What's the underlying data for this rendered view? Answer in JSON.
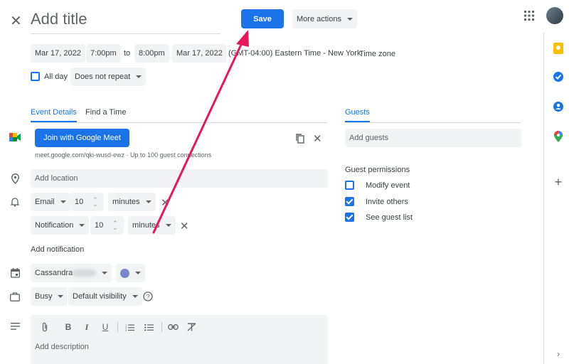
{
  "header": {
    "title_placeholder": "Add title",
    "save_label": "Save",
    "more_actions_label": "More actions"
  },
  "datetime": {
    "start_date": "Mar 17, 2022",
    "start_time": "7:00pm",
    "to_label": "to",
    "end_time": "8:00pm",
    "end_date": "Mar 17, 2022",
    "timezone_text": "(GMT-04:00) Eastern Time - New York",
    "timezone_link": "Time zone",
    "all_day_label": "All day",
    "repeat_label": "Does not repeat"
  },
  "tabs": {
    "event_details": "Event Details",
    "find_time": "Find a Time",
    "guests": "Guests"
  },
  "meet": {
    "button_label": "Join with Google Meet",
    "link_text": "meet.google.com/qki-wusd-ewz · Up to 100 guest connections"
  },
  "location": {
    "placeholder": "Add location"
  },
  "notifications": [
    {
      "type": "Email",
      "amount": "10",
      "unit": "minutes"
    },
    {
      "type": "Notification",
      "amount": "10",
      "unit": "minutes"
    }
  ],
  "add_notification_label": "Add notification",
  "calendar": {
    "owner": "Cassandra",
    "color": "#7986cb"
  },
  "availability": {
    "status": "Busy",
    "visibility": "Default visibility"
  },
  "description": {
    "placeholder": "Add description"
  },
  "guests": {
    "placeholder": "Add guests",
    "permissions_title": "Guest permissions",
    "permissions": [
      {
        "label": "Modify event",
        "checked": false
      },
      {
        "label": "Invite others",
        "checked": true
      },
      {
        "label": "See guest list",
        "checked": true
      }
    ]
  },
  "colors": {
    "accent": "#1a73e8",
    "annotation_arrow": "#e8175d",
    "keep": "#fbbc04",
    "tasks": "#1a73e8",
    "contacts": "#1a73e8"
  }
}
